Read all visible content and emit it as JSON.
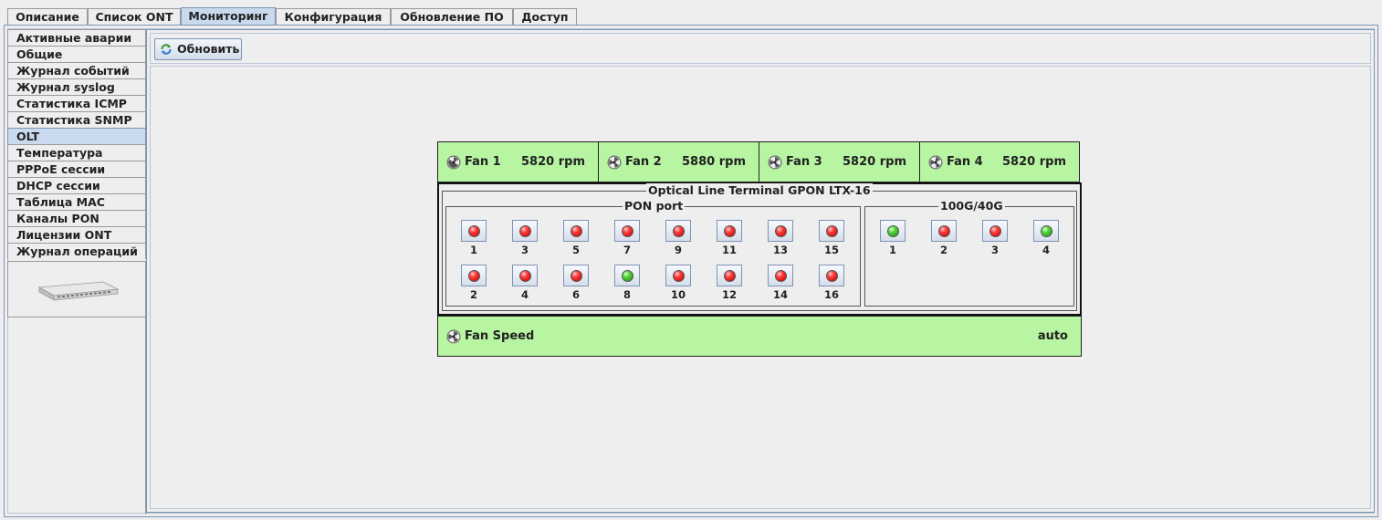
{
  "tabs": [
    "Описание",
    "Список ONT",
    "Мониторинг",
    "Конфигурация",
    "Обновление ПО",
    "Доступ"
  ],
  "active_tab": "Мониторинг",
  "sidebar": {
    "items": [
      "Активные аварии",
      "Общие",
      "Журнал событий",
      "Журнал syslog",
      "Статистика ICMP",
      "Статистика SNMP",
      "OLT",
      "Температура",
      "PPPoE сессии",
      "DHCP сессии",
      "Таблица MAC",
      "Каналы PON",
      "Лицензии ONT",
      "Журнал операций"
    ],
    "active_item": "OLT"
  },
  "toolbar": {
    "refresh_label": "Обновить",
    "refresh_icon": "refresh-icon"
  },
  "fans": [
    {
      "name": "Fan 1",
      "rpm": "5820 rpm"
    },
    {
      "name": "Fan 2",
      "rpm": "5880 rpm"
    },
    {
      "name": "Fan 3",
      "rpm": "5820 rpm"
    },
    {
      "name": "Fan 4",
      "rpm": "5820 rpm"
    }
  ],
  "olt": {
    "title": "Optical Line Terminal GPON LTX-16",
    "pon_group": {
      "label": "PON port",
      "ports": [
        {
          "num": "1",
          "status": "red"
        },
        {
          "num": "2",
          "status": "red"
        },
        {
          "num": "3",
          "status": "red"
        },
        {
          "num": "4",
          "status": "red"
        },
        {
          "num": "5",
          "status": "red"
        },
        {
          "num": "6",
          "status": "red"
        },
        {
          "num": "7",
          "status": "red"
        },
        {
          "num": "8",
          "status": "green"
        },
        {
          "num": "9",
          "status": "red"
        },
        {
          "num": "10",
          "status": "red"
        },
        {
          "num": "11",
          "status": "red"
        },
        {
          "num": "12",
          "status": "red"
        },
        {
          "num": "13",
          "status": "red"
        },
        {
          "num": "14",
          "status": "red"
        },
        {
          "num": "15",
          "status": "red"
        },
        {
          "num": "16",
          "status": "red"
        }
      ]
    },
    "uplink_group": {
      "label": "100G/40G",
      "ports": [
        {
          "num": "1",
          "status": "green"
        },
        {
          "num": "2",
          "status": "red"
        },
        {
          "num": "3",
          "status": "red"
        },
        {
          "num": "4",
          "status": "green"
        }
      ]
    }
  },
  "fan_speed": {
    "label": "Fan Speed",
    "value": "auto"
  },
  "colors": {
    "panel_green": "#b8f5a2",
    "active_blue": "#c9daee",
    "led_red": "#ff3a3a",
    "led_green": "#52d43a"
  }
}
